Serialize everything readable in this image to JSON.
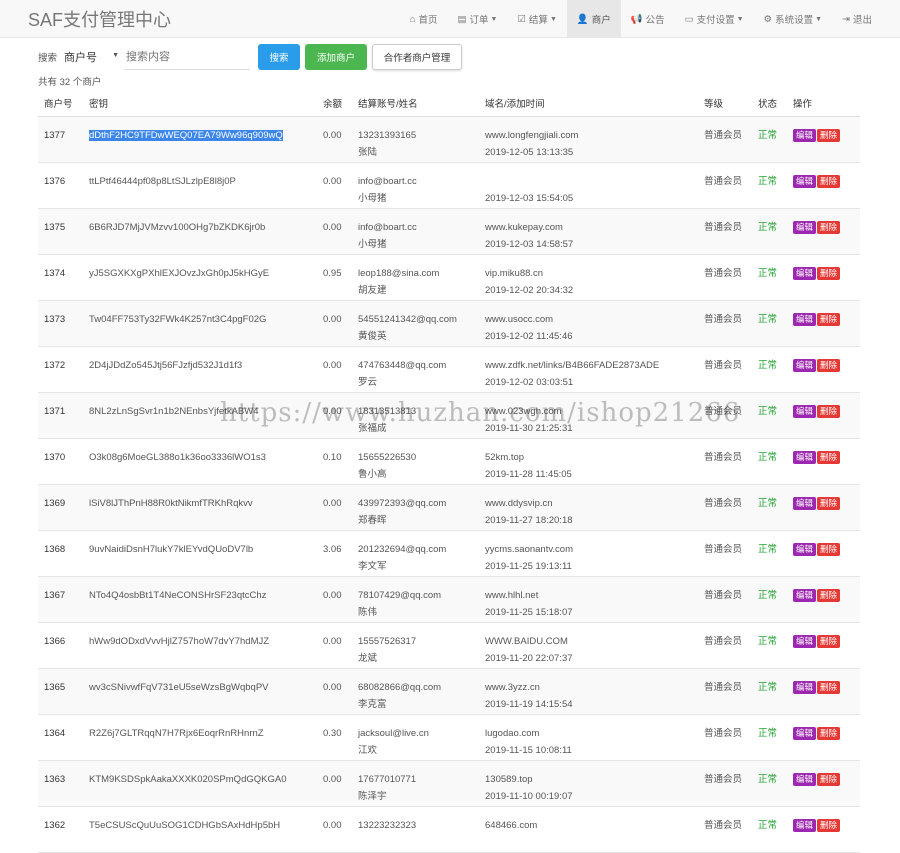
{
  "brand": "SAF支付管理中心",
  "nav": [
    {
      "icon": "⌂",
      "icon_name": "home-icon",
      "label": "首页",
      "caret": false,
      "active": false
    },
    {
      "icon": "▤",
      "icon_name": "list-icon",
      "label": "订单",
      "caret": true,
      "active": false
    },
    {
      "icon": "☑",
      "icon_name": "check-square-icon",
      "label": "结算",
      "caret": true,
      "active": false
    },
    {
      "icon": "👤",
      "icon_name": "user-icon",
      "label": "商户",
      "caret": false,
      "active": true
    },
    {
      "icon": "📢",
      "icon_name": "bullhorn-icon",
      "label": "公告",
      "caret": false,
      "active": false
    },
    {
      "icon": "▭",
      "icon_name": "credit-card-icon",
      "label": "支付设置",
      "caret": true,
      "active": false
    },
    {
      "icon": "⚙",
      "icon_name": "gear-icon",
      "label": "系统设置",
      "caret": true,
      "active": false
    },
    {
      "icon": "⇥",
      "icon_name": "logout-icon",
      "label": "退出",
      "caret": false,
      "active": false
    }
  ],
  "toolbar": {
    "search_label": "搜索",
    "select_value": "商户号",
    "search_placeholder": "搜索内容",
    "search_button": "搜索",
    "add_button": "添加商户",
    "partner_button": "合作者商户管理"
  },
  "count_text": "共有 32 个商户",
  "columns": [
    "商户号",
    "密钥",
    "余额",
    "结算账号/姓名",
    "域名/添加时间",
    "等级",
    "状态",
    "操作"
  ],
  "actions": {
    "edit": "编辑",
    "delete": "删除"
  },
  "rows": [
    {
      "id": "1377",
      "key": "dDthF2HC9TFDwWEQ07EA79Ww96q909wQ",
      "balance": "0.00",
      "account": "13231393165",
      "name": "张陆",
      "domain": "www.longfengjiali.com",
      "time": "2019-12-05 13:13:35",
      "level": "普通会员",
      "status": "正常"
    },
    {
      "id": "1376",
      "key": "ttLPtf46444pf08p8LtSJLzlpE8l8j0P",
      "balance": "0.00",
      "account": "info@boart.cc",
      "name": "小母猪",
      "domain": "",
      "time": "2019-12-03 15:54:05",
      "level": "普通会员",
      "status": "正常"
    },
    {
      "id": "1375",
      "key": "6B6RJD7MjJVMzvv100OHg7bZKDK6jr0b",
      "balance": "0.00",
      "account": "info@boart.cc",
      "name": "小母猪",
      "domain": "www.kukepay.com",
      "time": "2019-12-03 14:58:57",
      "level": "普通会员",
      "status": "正常"
    },
    {
      "id": "1374",
      "key": "yJ5SGXKXgPXhlEXJOvzJxGh0pJ5kHGyE",
      "balance": "0.95",
      "account": "leop188@sina.com",
      "name": "胡友建",
      "domain": "vip.miku88.cn",
      "time": "2019-12-02 20:34:32",
      "level": "普通会员",
      "status": "正常"
    },
    {
      "id": "1373",
      "key": "Tw04FF753Ty32FWk4K257nt3C4pgF02G",
      "balance": "0.00",
      "account": "54551241342@qq.com",
      "name": "黄俊英",
      "domain": "www.usocc.com",
      "time": "2019-12-02 11:45:46",
      "level": "普通会员",
      "status": "正常"
    },
    {
      "id": "1372",
      "key": "2D4jJDdZo545Jtj56FJzfjd532J1d1f3",
      "balance": "0.00",
      "account": "474763448@qq.com",
      "name": "罗云",
      "domain": "www.zdfk.net/links/B4B66FADE2873ADE",
      "time": "2019-12-02 03:03:51",
      "level": "普通会员",
      "status": "正常"
    },
    {
      "id": "1371",
      "key": "8NL2zLnSgSvr1n1b2NEnbsYjfetkABW4",
      "balance": "0.00",
      "account": "18313513813",
      "name": "张福成",
      "domain": "www.023wgh.com",
      "time": "2019-11-30 21:25:31",
      "level": "普通会员",
      "status": "正常"
    },
    {
      "id": "1370",
      "key": "O3k08g6MoeGL388o1k36oo3336lWO1s3",
      "balance": "0.10",
      "account": "15655226530",
      "name": "鲁小高",
      "domain": "52km.top",
      "time": "2019-11-28 11:45:05",
      "level": "普通会员",
      "status": "正常"
    },
    {
      "id": "1369",
      "key": "lSiV8lJThPnH88R0ktNikmfTRKhRqkvv",
      "balance": "0.00",
      "account": "439972393@qq.com",
      "name": "郑春晖",
      "domain": "www.ddysvip.cn",
      "time": "2019-11-27 18:20:18",
      "level": "普通会员",
      "status": "正常"
    },
    {
      "id": "1368",
      "key": "9uvNaidiDsnH7lukY7klEYvdQUoDV7lb",
      "balance": "3.06",
      "account": "201232694@qq.com",
      "name": "李文军",
      "domain": "yycms.saonantv.com",
      "time": "2019-11-25 19:13:11",
      "level": "普通会员",
      "status": "正常"
    },
    {
      "id": "1367",
      "key": "NTo4Q4osbBt1T4NeCONSHrSF23qtcChz",
      "balance": "0.00",
      "account": "78107429@qq.com",
      "name": "陈伟",
      "domain": "www.hlhl.net",
      "time": "2019-11-25 15:18:07",
      "level": "普通会员",
      "status": "正常"
    },
    {
      "id": "1366",
      "key": "hWw9dODxdVvvHjlZ757hoW7dvY7hdMJZ",
      "balance": "0.00",
      "account": "15557526317",
      "name": "龙斌",
      "domain": "WWW.BAIDU.COM",
      "time": "2019-11-20 22:07:37",
      "level": "普通会员",
      "status": "正常"
    },
    {
      "id": "1365",
      "key": "wv3cSNivwfFqV731eU5seWzsBgWqbqPV",
      "balance": "0.00",
      "account": "68082866@qq.com",
      "name": "李克富",
      "domain": "www.3yzz.cn",
      "time": "2019-11-19 14:15:54",
      "level": "普通会员",
      "status": "正常"
    },
    {
      "id": "1364",
      "key": "R2Z6j7GLTRqqN7H7Rjx6EoqrRnRHnrnZ",
      "balance": "0.30",
      "account": "jacksoul@live.cn",
      "name": "江欢",
      "domain": "lugodao.com",
      "time": "2019-11-15 10:08:11",
      "level": "普通会员",
      "status": "正常"
    },
    {
      "id": "1363",
      "key": "KTM9KSDSpkAakaXXXK020SPmQdGQKGA0",
      "balance": "0.00",
      "account": "17677010771",
      "name": "陈泽宇",
      "domain": "130589.top",
      "time": "2019-11-10 00:19:07",
      "level": "普通会员",
      "status": "正常"
    },
    {
      "id": "1362",
      "key": "T5eCSUScQuUuSOG1CDHGbSAxHdHp5bH",
      "balance": "0.00",
      "account": "13223232323",
      "name": "",
      "domain": "648466.com",
      "time": "",
      "level": "普通会员",
      "status": "正常"
    }
  ],
  "watermark": "https://www.huzhan.com/ishop21266"
}
